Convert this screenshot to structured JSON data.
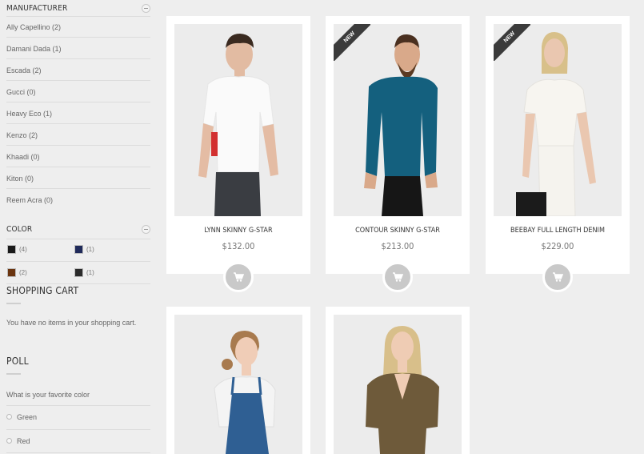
{
  "sidebar": {
    "manufacturer": {
      "title": "MANUFACTURER",
      "items": [
        {
          "label": "Ally Capellino (2)"
        },
        {
          "label": "Damani Dada (1)"
        },
        {
          "label": "Escada (2)"
        },
        {
          "label": "Gucci (0)"
        },
        {
          "label": "Heavy Eco (1)"
        },
        {
          "label": "Kenzo (2)"
        },
        {
          "label": "Khaadi (0)"
        },
        {
          "label": "Kiton (0)"
        },
        {
          "label": "Reem Acra (0)"
        }
      ]
    },
    "color": {
      "title": "COLOR",
      "swatches": [
        {
          "color": "#1a1a1a",
          "count": "(4)"
        },
        {
          "color": "#1f2a5a",
          "count": "(1)"
        },
        {
          "color": "#6b3510",
          "count": "(2)"
        },
        {
          "color": "#2b2b2b",
          "count": "(1)"
        }
      ]
    },
    "cart": {
      "title": "SHOPPING CART",
      "empty_text": "You have no items in your shopping cart."
    },
    "poll": {
      "title": "POLL",
      "question": "What is your favorite color",
      "options": [
        {
          "label": "Green"
        },
        {
          "label": "Red"
        }
      ]
    }
  },
  "products": [
    {
      "name": "LYNN SKINNY G-STAR",
      "price": "$132.00",
      "new": false
    },
    {
      "name": "CONTOUR SKINNY G-STAR",
      "price": "$213.00",
      "new": true,
      "badge": "NEW"
    },
    {
      "name": "BEEBAY FULL LENGTH DENIM",
      "price": "$229.00",
      "new": true,
      "badge": "NEW"
    },
    {
      "name": "",
      "price": "",
      "new": false
    },
    {
      "name": "",
      "price": "",
      "new": false
    }
  ],
  "icons": {
    "cart": "cart-icon",
    "collapse": "minus-circle-icon"
  }
}
